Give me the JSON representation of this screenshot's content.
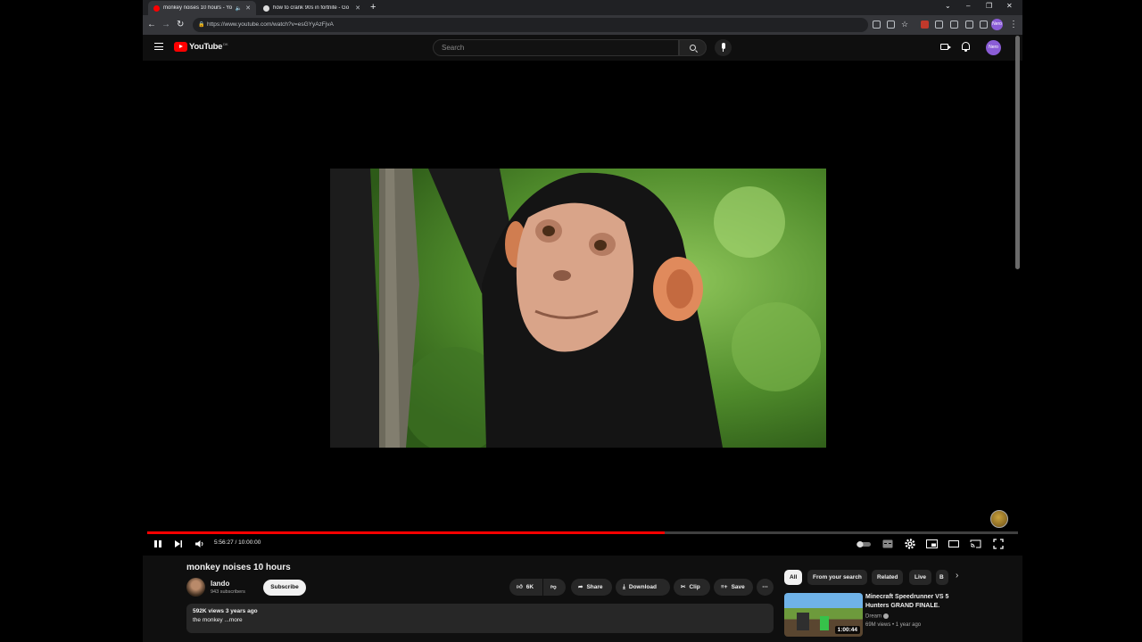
{
  "browser": {
    "tabs": [
      {
        "title": "monkey noises 10 hours - Yo",
        "favicon_color": "#ff0000",
        "active": true
      },
      {
        "title": "how to crank 90s in fortnite - Go",
        "favicon_color": "#dddddd",
        "active": false
      }
    ],
    "new_tab_label": "+",
    "url": "https://www.youtube.com/watch?v=esGYyAzFjvA",
    "profile_label": "Nero"
  },
  "header": {
    "logo_text": "YouTube",
    "logo_region": "DK",
    "search_placeholder": "Search",
    "avatar_label": "Nero"
  },
  "player": {
    "time": "5:56:27 / 10:00:00",
    "progress_fraction": 0.5941
  },
  "video": {
    "title": "monkey noises 10 hours",
    "channel": "lando",
    "subscribers": "943 subscribers",
    "subscribe_label": "Subscribe",
    "like_count": "6K",
    "share_label": "Share",
    "download_label": "Download",
    "clip_label": "Clip",
    "save_label": "Save",
    "more_label": "⋯",
    "views_age": "592K views  3 years ago",
    "description": "the monkey ...more"
  },
  "chips": [
    "All",
    "From your search",
    "Related",
    "Live",
    "B"
  ],
  "recommendation": {
    "title": "Minecraft Speedrunner VS 5 Hunters GRAND FINALE.",
    "channel": "Dream",
    "meta": "69M views  • 1 year ago",
    "duration": "1:00:44"
  }
}
